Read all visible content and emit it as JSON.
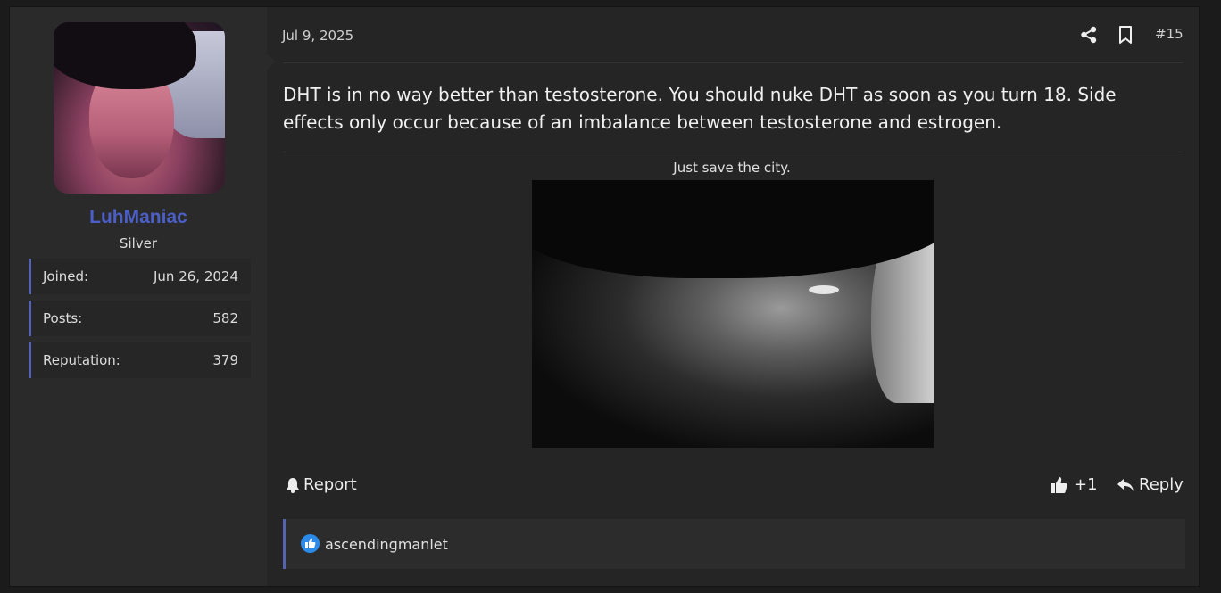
{
  "user": {
    "name": "LuhManiac",
    "rank": "Silver",
    "stats": [
      {
        "label": "Joined:",
        "value": "Jun 26, 2024"
      },
      {
        "label": "Posts:",
        "value": "582"
      },
      {
        "label": "Reputation:",
        "value": "379"
      }
    ]
  },
  "post": {
    "date": "Jul 9, 2025",
    "number": "#15",
    "body": "DHT is in no way better than testosterone. You should nuke DHT as soon as you turn 18. Side effects only occur because of an imbalance between testosterone and estrogen.",
    "signature_caption": "Just save the city."
  },
  "actions": {
    "report": "Report",
    "like_count": "+1",
    "reply": "Reply"
  },
  "reactions": {
    "users": [
      "ascendingmanlet"
    ]
  },
  "colors": {
    "username": "#4c5fc7",
    "accent_border": "#5563b0",
    "reaction_blue": "#2a8bea"
  }
}
